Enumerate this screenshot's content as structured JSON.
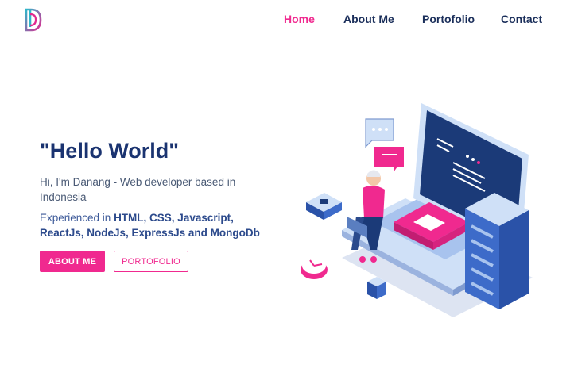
{
  "nav": {
    "links": [
      "Home",
      "About Me",
      "Portofolio",
      "Contact"
    ],
    "active": "Home"
  },
  "hero": {
    "title": "\"Hello World\"",
    "subtitle": "Hi, I'm Danang - Web developer based in Indonesia",
    "skills_prefix": "Experienced in ",
    "skills_bold": "HTML, CSS, Javascript, ReactJs, NodeJs, ExpressJs and MongoDb",
    "primary_button": "About Me",
    "secondary_button": "Portofolio"
  },
  "colors": {
    "accent": "#f0298f",
    "navy": "#1a2e5a",
    "title": "#1a3370"
  },
  "icons": {
    "logo": "letter-d-logo-icon",
    "illustration": "developer-laptop-server-illustration"
  }
}
